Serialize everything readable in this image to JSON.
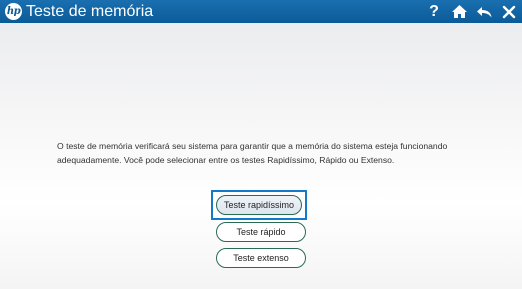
{
  "window": {
    "title": "Teste de memória",
    "logo_text": "hp"
  },
  "toolbar": {
    "help_label": "?",
    "icons": [
      "help-icon",
      "home-icon",
      "back-icon",
      "close-icon"
    ]
  },
  "main": {
    "description": "O teste de memória verificará seu sistema para garantir que a memória do sistema esteja funcionando adequadamente. Você pode selecionar entre os testes Rapidíssimo, Rápido ou Extenso.",
    "buttons": [
      {
        "label": "Teste rapidíssimo",
        "selected": true
      },
      {
        "label": "Teste rápido",
        "selected": false
      },
      {
        "label": "Teste extenso",
        "selected": false
      }
    ]
  },
  "colors": {
    "titlebar": "#0b5b98",
    "focus_ring": "#1479c8",
    "button_border": "#2a6b54"
  }
}
